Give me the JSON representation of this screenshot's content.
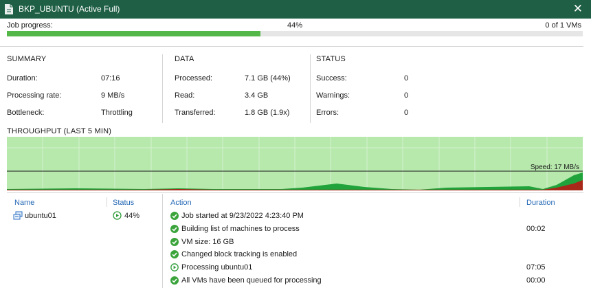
{
  "window": {
    "title": "BKP_UBUNTU (Active Full)",
    "close_glyph": "✕"
  },
  "progress": {
    "label": "Job progress:",
    "percent_text": "44%",
    "value": 0.44,
    "vms_text": "0 of 1 VMs"
  },
  "summary": {
    "title": "SUMMARY",
    "rows": [
      {
        "label": "Duration:",
        "value": "07:16"
      },
      {
        "label": "Processing rate:",
        "value": "9 MB/s"
      },
      {
        "label": "Bottleneck:",
        "value": "Throttling"
      }
    ]
  },
  "data": {
    "title": "DATA",
    "rows": [
      {
        "label": "Processed:",
        "value": "7.1 GB (44%)"
      },
      {
        "label": "Read:",
        "value": "3.4 GB"
      },
      {
        "label": "Transferred:",
        "value": "1.8 GB (1.9x)"
      }
    ]
  },
  "status": {
    "title": "STATUS",
    "rows": [
      {
        "label": "Success:",
        "value": "0"
      },
      {
        "label": "Warnings:",
        "value": "0"
      },
      {
        "label": "Errors:",
        "value": "0"
      }
    ]
  },
  "throughput": {
    "title": "THROUGHPUT (LAST 5 MIN)",
    "speed_label": "Speed: 17 MB/s",
    "colors": {
      "background": "#b7e8ac",
      "grid": "#d6f2cf",
      "green": "#1fa33a",
      "red": "#a8281a",
      "line": "#1a1a1a"
    }
  },
  "vm_list": {
    "headers": {
      "name": "Name",
      "status": "Status"
    },
    "rows": [
      {
        "name": "ubuntu01",
        "status": "44%",
        "icon": "vm-icon",
        "status_icon": "running-icon"
      }
    ]
  },
  "log": {
    "headers": {
      "action": "Action",
      "duration": "Duration"
    },
    "rows": [
      {
        "icon": "success-icon",
        "action": "Job started at 9/23/2022 4:23:40 PM",
        "duration": ""
      },
      {
        "icon": "success-icon",
        "action": "Building list of machines to process",
        "duration": "00:02"
      },
      {
        "icon": "success-icon",
        "action": "VM size: 16 GB",
        "duration": ""
      },
      {
        "icon": "success-icon",
        "action": "Changed block tracking is enabled",
        "duration": ""
      },
      {
        "icon": "running-icon",
        "action": "Processing ubuntu01",
        "duration": "07:05"
      },
      {
        "icon": "success-icon",
        "action": "All VMs have been queued for processing",
        "duration": "00:00"
      }
    ]
  }
}
